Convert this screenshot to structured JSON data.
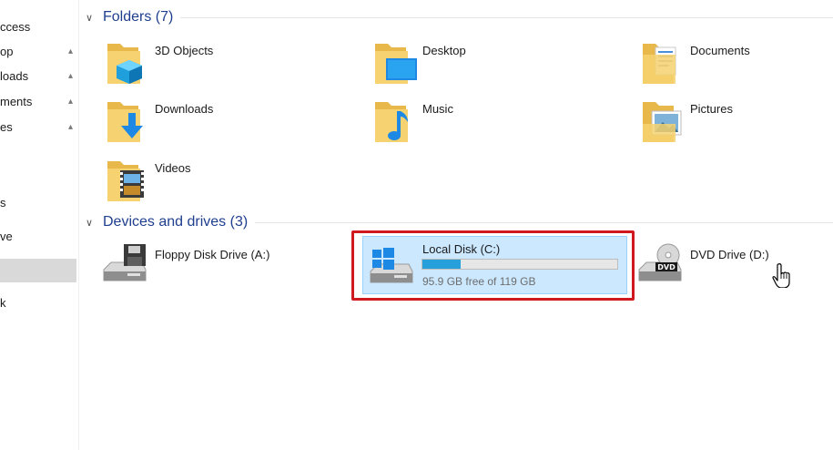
{
  "nav": {
    "items": [
      {
        "label": "ccess",
        "pinned": false
      },
      {
        "label": "op",
        "pinned": true
      },
      {
        "label": "loads",
        "pinned": true
      },
      {
        "label": "ments",
        "pinned": true
      },
      {
        "label": "es",
        "pinned": true
      },
      {
        "label": "",
        "pinned": false
      },
      {
        "label": "s",
        "pinned": false
      },
      {
        "label": "ve",
        "pinned": false
      },
      {
        "label": "",
        "pinned": false
      },
      {
        "label": "k",
        "pinned": false
      }
    ],
    "pin_glyph": "📌"
  },
  "folders": {
    "header": "Folders (7)",
    "items": [
      {
        "label": "3D Objects",
        "icon": "3d-objects-folder-icon"
      },
      {
        "label": "Desktop",
        "icon": "desktop-folder-icon"
      },
      {
        "label": "Documents",
        "icon": "documents-folder-icon"
      },
      {
        "label": "Downloads",
        "icon": "downloads-folder-icon"
      },
      {
        "label": "Music",
        "icon": "music-folder-icon"
      },
      {
        "label": "Pictures",
        "icon": "pictures-folder-icon"
      },
      {
        "label": "Videos",
        "icon": "videos-folder-icon"
      }
    ]
  },
  "devices": {
    "header": "Devices and drives (3)",
    "items": [
      {
        "label": "Floppy Disk Drive (A:)",
        "icon": "floppy-drive-icon"
      },
      {
        "label": "Local Disk (C:)",
        "icon": "local-disk-icon",
        "free_text": "95.9 GB free of 119 GB",
        "used_fraction": 0.194,
        "selected": true
      },
      {
        "label": "DVD Drive (D:)",
        "icon": "dvd-drive-icon"
      }
    ]
  },
  "colors": {
    "accent": "#26a0da",
    "selection": "#cce8ff",
    "highlight": "#d0181f",
    "header_text": "#1f3e8f"
  }
}
